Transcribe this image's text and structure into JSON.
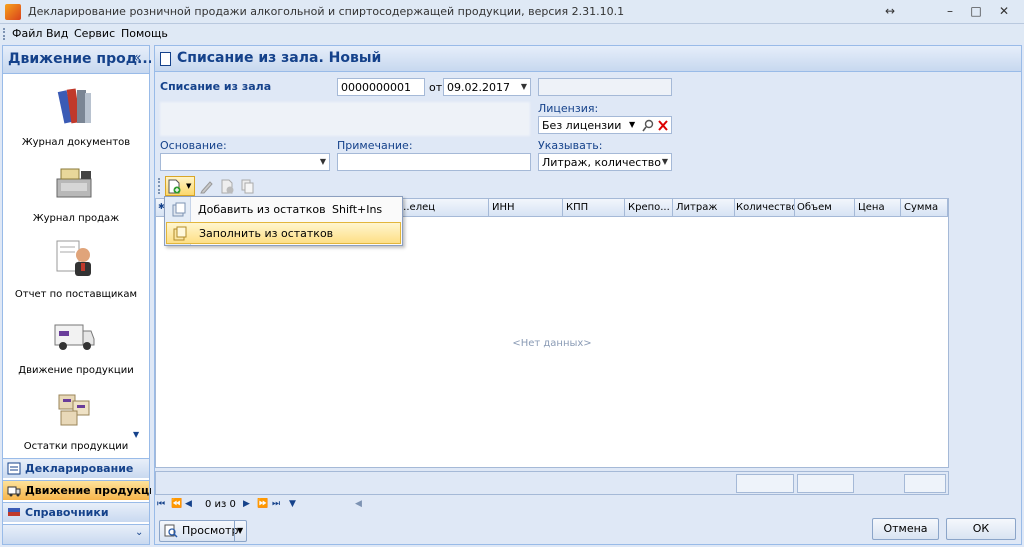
{
  "window": {
    "title": "Декларирование розничной продажи алкогольной и спиртосодержащей продукции, версия 2.31.10.1",
    "resize_glyph": "↔",
    "minimize": "–",
    "maximize": "□",
    "close": "✕"
  },
  "menu": [
    "Файл",
    "Вид",
    "Сервис",
    "Помощь"
  ],
  "sidebar": {
    "header": "Движение прод...",
    "collapse": "«",
    "items": [
      {
        "label": "Журнал документов",
        "icon": "books-icon"
      },
      {
        "label": "Журнал продаж",
        "icon": "cash-register-icon"
      },
      {
        "label": "Отчет по поставщикам",
        "icon": "supplier-report-icon"
      },
      {
        "label": "Движение продукции",
        "icon": "delivery-van-icon"
      },
      {
        "label": "Остатки продукции",
        "icon": "boxes-icon"
      }
    ],
    "scroll_down": "▼",
    "groups": [
      {
        "label": "Декларирование",
        "active": false
      },
      {
        "label": "Движение продукции",
        "active": true
      },
      {
        "label": "Справочники",
        "active": false
      }
    ],
    "more": "⌄"
  },
  "document": {
    "title": "Списание из зала. Новый",
    "doc_type_label": "Списание из зала",
    "number": "0000000001",
    "date_prefix": "от",
    "date": "09.02.2017",
    "license_label": "Лицензия:",
    "license_value": "Без лицензии",
    "basis_label": "Основание:",
    "basis_value": "",
    "note_label": "Примечание:",
    "note_value": "",
    "indicate_label": "Указывать:",
    "indicate_value": "Литраж, количество"
  },
  "grid": {
    "columns": [
      "",
      "",
      "...елец",
      "ИНН",
      "КПП",
      "Крепо...",
      "Литраж",
      "Количество",
      "Объем",
      "Цена",
      "Сумма"
    ],
    "empty_text": "<Нет данных>"
  },
  "navigator": {
    "position": "0 из 0"
  },
  "popup_menu": {
    "items": [
      {
        "label": "Добавить из остатков",
        "shortcut": "Shift+Ins",
        "highlighted": false
      },
      {
        "label": "Заполнить из остатков",
        "shortcut": "",
        "highlighted": true
      }
    ]
  },
  "buttons": {
    "preview": "Просмотр",
    "cancel": "Отмена",
    "ok": "ОК"
  },
  "colors": {
    "accent": "#15428b",
    "active_group": "#f7b54b"
  }
}
